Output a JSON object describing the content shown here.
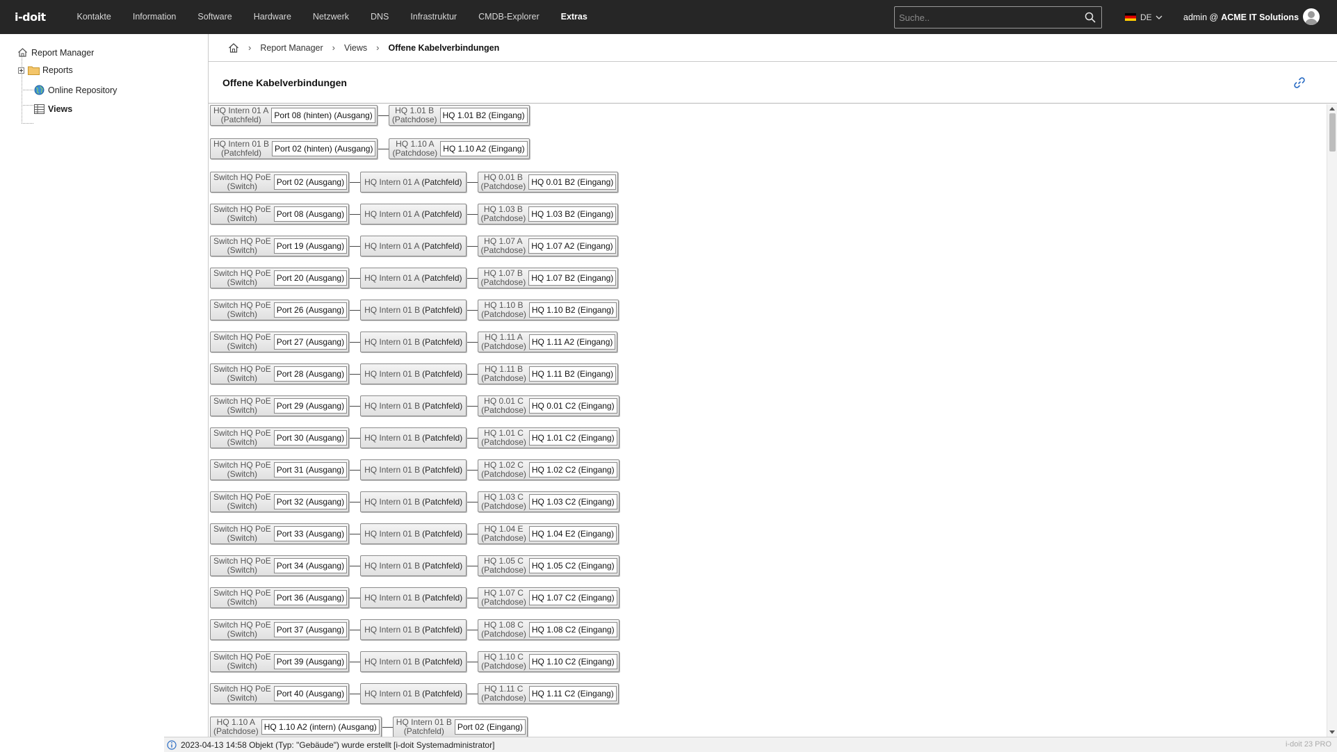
{
  "app": {
    "logo_text": "i-doit"
  },
  "nav": {
    "items": [
      "Kontakte",
      "Information",
      "Software",
      "Hardware",
      "Netzwerk",
      "DNS",
      "Infrastruktur",
      "CMDB-Explorer",
      "Extras"
    ],
    "active": "Extras"
  },
  "search": {
    "placeholder": "Suche.."
  },
  "language": {
    "code": "DE",
    "flag": "german-flag-icon"
  },
  "user": {
    "name": "admin @",
    "org": "ACME IT Solutions"
  },
  "sidebar": {
    "items": [
      {
        "label": "Report Manager",
        "icon": "home-icon"
      },
      {
        "label": "Reports",
        "icon": "folder-icon"
      },
      {
        "label": "Online Repository",
        "icon": "globe-icon"
      },
      {
        "label": "Views",
        "icon": "table-icon"
      }
    ]
  },
  "breadcrumb": {
    "items": [
      "Report Manager",
      "Views",
      "Offene Kabelverbindungen"
    ]
  },
  "page": {
    "title": "Offene Kabelverbindungen"
  },
  "connections": [
    [
      {
        "name": [
          "HQ Intern 01 A",
          "(Patchfeld)"
        ],
        "port": "Port 08 (hinten) (Ausgang)"
      },
      {
        "name": [
          "HQ 1.01 B",
          "(Patchdose)"
        ],
        "port": "HQ 1.01 B2 (Eingang)"
      }
    ],
    [
      {
        "name": [
          "HQ Intern 01 B",
          "(Patchfeld)"
        ],
        "port": "Port 02 (hinten) (Ausgang)"
      },
      {
        "name": [
          "HQ 1.10 A",
          "(Patchdose)"
        ],
        "port": "HQ 1.10 A2 (Eingang)"
      }
    ],
    [
      {
        "name": [
          "Switch HQ PoE",
          "(Switch)"
        ],
        "port": "Port 02 (Ausgang)"
      },
      {
        "inline": [
          "HQ Intern 01 A",
          "(Patchfeld)"
        ]
      },
      {
        "name": [
          "HQ 0.01 B",
          "(Patchdose)"
        ],
        "port": "HQ 0.01 B2 (Eingang)"
      }
    ],
    [
      {
        "name": [
          "Switch HQ PoE",
          "(Switch)"
        ],
        "port": "Port 08 (Ausgang)"
      },
      {
        "inline": [
          "HQ Intern 01 A",
          "(Patchfeld)"
        ]
      },
      {
        "name": [
          "HQ 1.03 B",
          "(Patchdose)"
        ],
        "port": "HQ 1.03 B2 (Eingang)"
      }
    ],
    [
      {
        "name": [
          "Switch HQ PoE",
          "(Switch)"
        ],
        "port": "Port 19 (Ausgang)"
      },
      {
        "inline": [
          "HQ Intern 01 A",
          "(Patchfeld)"
        ]
      },
      {
        "name": [
          "HQ 1.07 A",
          "(Patchdose)"
        ],
        "port": "HQ 1.07 A2 (Eingang)"
      }
    ],
    [
      {
        "name": [
          "Switch HQ PoE",
          "(Switch)"
        ],
        "port": "Port 20 (Ausgang)"
      },
      {
        "inline": [
          "HQ Intern 01 A",
          "(Patchfeld)"
        ]
      },
      {
        "name": [
          "HQ 1.07 B",
          "(Patchdose)"
        ],
        "port": "HQ 1.07 B2 (Eingang)"
      }
    ],
    [
      {
        "name": [
          "Switch HQ PoE",
          "(Switch)"
        ],
        "port": "Port 26 (Ausgang)"
      },
      {
        "inline": [
          "HQ Intern 01 B",
          "(Patchfeld)"
        ]
      },
      {
        "name": [
          "HQ 1.10 B",
          "(Patchdose)"
        ],
        "port": "HQ 1.10 B2 (Eingang)"
      }
    ],
    [
      {
        "name": [
          "Switch HQ PoE",
          "(Switch)"
        ],
        "port": "Port 27 (Ausgang)"
      },
      {
        "inline": [
          "HQ Intern 01 B",
          "(Patchfeld)"
        ]
      },
      {
        "name": [
          "HQ 1.11 A",
          "(Patchdose)"
        ],
        "port": "HQ 1.11 A2 (Eingang)"
      }
    ],
    [
      {
        "name": [
          "Switch HQ PoE",
          "(Switch)"
        ],
        "port": "Port 28 (Ausgang)"
      },
      {
        "inline": [
          "HQ Intern 01 B",
          "(Patchfeld)"
        ]
      },
      {
        "name": [
          "HQ 1.11 B",
          "(Patchdose)"
        ],
        "port": "HQ 1.11 B2 (Eingang)"
      }
    ],
    [
      {
        "name": [
          "Switch HQ PoE",
          "(Switch)"
        ],
        "port": "Port 29 (Ausgang)"
      },
      {
        "inline": [
          "HQ Intern 01 B",
          "(Patchfeld)"
        ]
      },
      {
        "name": [
          "HQ 0.01 C",
          "(Patchdose)"
        ],
        "port": "HQ 0.01 C2 (Eingang)"
      }
    ],
    [
      {
        "name": [
          "Switch HQ PoE",
          "(Switch)"
        ],
        "port": "Port 30 (Ausgang)"
      },
      {
        "inline": [
          "HQ Intern 01 B",
          "(Patchfeld)"
        ]
      },
      {
        "name": [
          "HQ 1.01 C",
          "(Patchdose)"
        ],
        "port": "HQ 1.01 C2 (Eingang)"
      }
    ],
    [
      {
        "name": [
          "Switch HQ PoE",
          "(Switch)"
        ],
        "port": "Port 31 (Ausgang)"
      },
      {
        "inline": [
          "HQ Intern 01 B",
          "(Patchfeld)"
        ]
      },
      {
        "name": [
          "HQ 1.02 C",
          "(Patchdose)"
        ],
        "port": "HQ 1.02 C2 (Eingang)"
      }
    ],
    [
      {
        "name": [
          "Switch HQ PoE",
          "(Switch)"
        ],
        "port": "Port 32 (Ausgang)"
      },
      {
        "inline": [
          "HQ Intern 01 B",
          "(Patchfeld)"
        ]
      },
      {
        "name": [
          "HQ 1.03 C",
          "(Patchdose)"
        ],
        "port": "HQ 1.03 C2 (Eingang)"
      }
    ],
    [
      {
        "name": [
          "Switch HQ PoE",
          "(Switch)"
        ],
        "port": "Port 33 (Ausgang)"
      },
      {
        "inline": [
          "HQ Intern 01 B",
          "(Patchfeld)"
        ]
      },
      {
        "name": [
          "HQ 1.04 E",
          "(Patchdose)"
        ],
        "port": "HQ 1.04 E2 (Eingang)"
      }
    ],
    [
      {
        "name": [
          "Switch HQ PoE",
          "(Switch)"
        ],
        "port": "Port 34 (Ausgang)"
      },
      {
        "inline": [
          "HQ Intern 01 B",
          "(Patchfeld)"
        ]
      },
      {
        "name": [
          "HQ 1.05 C",
          "(Patchdose)"
        ],
        "port": "HQ 1.05 C2 (Eingang)"
      }
    ],
    [
      {
        "name": [
          "Switch HQ PoE",
          "(Switch)"
        ],
        "port": "Port 36 (Ausgang)"
      },
      {
        "inline": [
          "HQ Intern 01 B",
          "(Patchfeld)"
        ]
      },
      {
        "name": [
          "HQ 1.07 C",
          "(Patchdose)"
        ],
        "port": "HQ 1.07 C2 (Eingang)"
      }
    ],
    [
      {
        "name": [
          "Switch HQ PoE",
          "(Switch)"
        ],
        "port": "Port 37 (Ausgang)"
      },
      {
        "inline": [
          "HQ Intern 01 B",
          "(Patchfeld)"
        ]
      },
      {
        "name": [
          "HQ 1.08 C",
          "(Patchdose)"
        ],
        "port": "HQ 1.08 C2 (Eingang)"
      }
    ],
    [
      {
        "name": [
          "Switch HQ PoE",
          "(Switch)"
        ],
        "port": "Port 39 (Ausgang)"
      },
      {
        "inline": [
          "HQ Intern 01 B",
          "(Patchfeld)"
        ]
      },
      {
        "name": [
          "HQ 1.10 C",
          "(Patchdose)"
        ],
        "port": "HQ 1.10 C2 (Eingang)"
      }
    ],
    [
      {
        "name": [
          "Switch HQ PoE",
          "(Switch)"
        ],
        "port": "Port 40 (Ausgang)"
      },
      {
        "inline": [
          "HQ Intern 01 B",
          "(Patchfeld)"
        ]
      },
      {
        "name": [
          "HQ 1.11 C",
          "(Patchdose)"
        ],
        "port": "HQ 1.11 C2 (Eingang)"
      }
    ],
    [
      {
        "name": [
          "HQ 1.10 A",
          "(Patchdose)"
        ],
        "port": "HQ 1.10 A2 (intern) (Ausgang)"
      },
      {
        "name": [
          "HQ Intern 01 B",
          "(Patchfeld)"
        ],
        "port": "Port 02 (Eingang)"
      }
    ]
  ],
  "statusbar": {
    "message": "2023-04-13 14:58 Objekt (Typ: \"Gebäude\") wurde erstellt [i-doit Systemadministrator]",
    "version": "i-doit 23 PRO"
  }
}
